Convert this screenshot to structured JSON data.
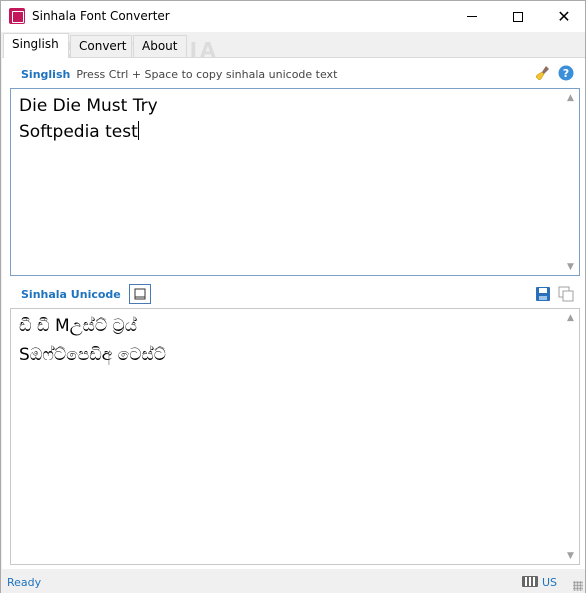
{
  "window": {
    "title": "Sinhala Font Converter",
    "watermark": "SOFTPEDIA"
  },
  "tabs": [
    {
      "label": "Singlish",
      "active": true
    },
    {
      "label": "Convert",
      "active": false
    },
    {
      "label": "About",
      "active": false
    }
  ],
  "singlish": {
    "title": "Singlish",
    "hint": "Press Ctrl + Space to copy sinhala unicode text",
    "line1": "Die Die Must Try",
    "line2": "Softpedia test"
  },
  "unicode": {
    "title": "Sinhala Unicode",
    "line1": "ඩී ඩී Mඋස්ට් ට්‍රය්",
    "line2": "Sඔෆ්ට්පෙඩිඅ ටෙස්ට්"
  },
  "status": {
    "text": "Ready",
    "language": "US"
  },
  "colors": {
    "accent": "#1e73be",
    "app_icon": "#c2185b"
  }
}
